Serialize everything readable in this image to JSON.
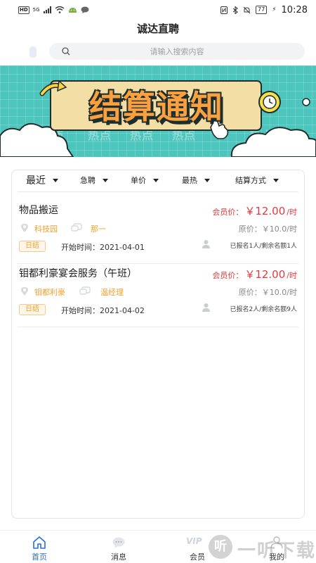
{
  "status_bar": {
    "hd": "HD",
    "net": "5G",
    "battery": "77",
    "time": "10:28"
  },
  "header": {
    "title": "诚达直聘"
  },
  "search": {
    "placeholder": "请输入搜索内容"
  },
  "banner": {
    "title": "结算通知",
    "hot_word": "热点"
  },
  "filters": [
    {
      "label": "最近"
    },
    {
      "label": "急聘"
    },
    {
      "label": "单价"
    },
    {
      "label": "最热"
    },
    {
      "label": "结算方式"
    }
  ],
  "jobs": [
    {
      "title": "物品搬运",
      "price_prefix": "会员价：",
      "price": "￥12.00",
      "price_unit": "/时",
      "location": "科技园",
      "contact": "那一",
      "original_price": "原价：￥10.0/时",
      "settle_tag": "日结",
      "start_time": "开始时间：2021-04-01",
      "enrollment": "已报名1人/剩余名额1人"
    },
    {
      "title": "钼都利豪宴会服务（午班）",
      "price_prefix": "会员价：",
      "price": "￥12.00",
      "price_unit": "/时",
      "location": "钼都利豪",
      "contact": "温经理",
      "original_price": "原价：￥10.0/时",
      "settle_tag": "日结",
      "start_time": "开始时间：2021-04-02",
      "enrollment": "已报名2人/剩余名额9人"
    }
  ],
  "tabbar": {
    "items": [
      {
        "label": "首页",
        "icon": "home-icon",
        "active": true
      },
      {
        "label": "消息",
        "icon": "message-icon"
      },
      {
        "label": "会员",
        "icon": "vip-icon"
      },
      {
        "label": "我的",
        "icon": "profile-icon"
      }
    ],
    "vip_mark": "VIP"
  },
  "watermark": {
    "glyph": "听",
    "text": "一听下载"
  },
  "colors": {
    "accent_blue": "#2c6cd6",
    "price_red": "#e4393c",
    "tag_orange": "#f0a030",
    "banner_teal": "#4cc5bd",
    "banner_title_orange": "#f9a03f"
  }
}
